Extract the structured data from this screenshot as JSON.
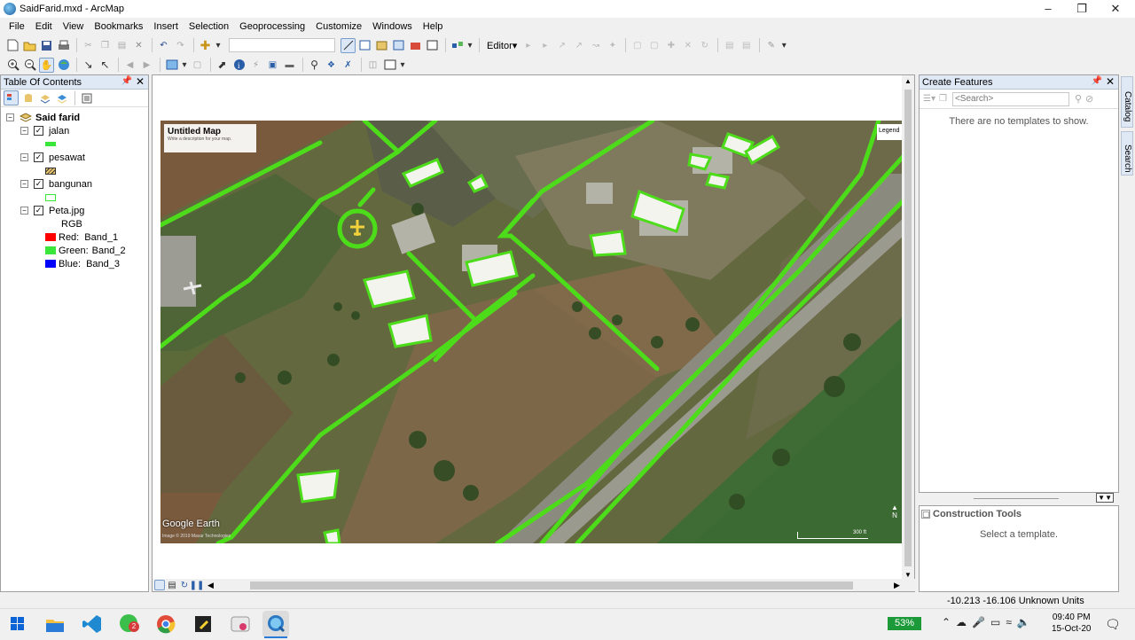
{
  "window": {
    "title": "SaidFarid.mxd - ArcMap"
  },
  "menu": [
    "File",
    "Edit",
    "View",
    "Bookmarks",
    "Insert",
    "Selection",
    "Geoprocessing",
    "Customize",
    "Windows",
    "Help"
  ],
  "toolbar": {
    "editor_label": "Editor▾"
  },
  "toc": {
    "title": "Table Of Contents",
    "dataframe": "Said farid",
    "layers": [
      {
        "name": "jalan",
        "checked": true
      },
      {
        "name": "pesawat",
        "checked": true
      },
      {
        "name": "bangunan",
        "checked": true
      },
      {
        "name": "Peta.jpg",
        "checked": true
      }
    ],
    "raster_mode": "RGB",
    "bands": [
      {
        "label": "Red:",
        "band": "Band_1",
        "color": "#ff0000"
      },
      {
        "label": "Green:",
        "band": "Band_2",
        "color": "#39e639"
      },
      {
        "label": "Blue:",
        "band": "Band_3",
        "color": "#0000ff"
      }
    ]
  },
  "map": {
    "overlay_title": "Untitled Map",
    "overlay_subtitle": "Write a description for your map.",
    "legend_label": "Legend",
    "google_label": "Google Earth",
    "copyright": "Image © 2019 Maxar Technologies",
    "scale_label": "300 ft",
    "north_label": "N"
  },
  "create_features": {
    "title": "Create Features",
    "search_placeholder": "<Search>",
    "no_templates": "There are no templates to show."
  },
  "construction": {
    "title": "Construction Tools",
    "message": "Select a template."
  },
  "side_tabs": {
    "catalog": "Catalog",
    "search": "Search"
  },
  "status": {
    "coords": "-10.213  -16.106 Unknown Units"
  },
  "taskbar": {
    "battery": "53%",
    "time": "09:40 PM",
    "date": "15-Oct-20",
    "chrome_badge": "2"
  },
  "colors": {
    "road_green": "#4ddc1a",
    "panel_head": "#dfe8f5"
  }
}
